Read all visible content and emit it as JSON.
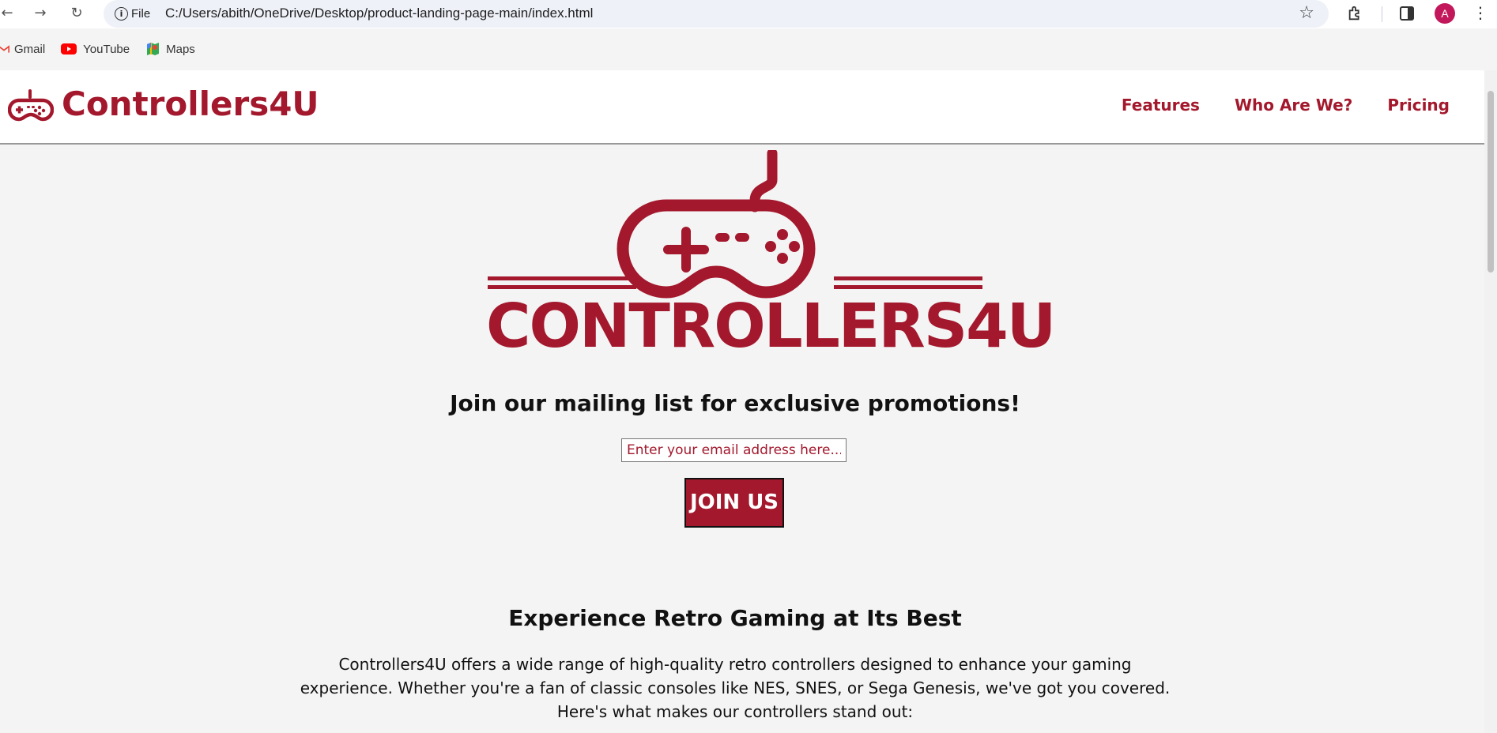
{
  "browser": {
    "file_chip_label": "File",
    "url": "C:/Users/abith/OneDrive/Desktop/product-landing-page-main/index.html",
    "avatar_letter": "A"
  },
  "bookmarks": [
    {
      "label": "Gmail",
      "icon": "gmail-icon"
    },
    {
      "label": "YouTube",
      "icon": "youtube-icon"
    },
    {
      "label": "Maps",
      "icon": "maps-icon"
    }
  ],
  "header": {
    "brand": "Controllers4U",
    "nav": [
      {
        "label": "Features"
      },
      {
        "label": "Who Are We?"
      },
      {
        "label": "Pricing"
      }
    ]
  },
  "hero": {
    "logo_text": "CONTROLLERS4U",
    "mailing_heading": "Join our mailing list for exclusive promotions!",
    "email_placeholder": "Enter your email address here...",
    "join_button": "JOIN US"
  },
  "section": {
    "heading": "Experience Retro Gaming at Its Best",
    "text": "Controllers4U offers a wide range of high-quality retro controllers designed to enhance your gaming experience. Whether you're a fan of classic consoles like NES, SNES, or Sega Genesis, we've got you covered. Here's what makes our controllers stand out:"
  },
  "colors": {
    "brand": "#a3182c",
    "page_bg": "#f4f4f4",
    "avatar": "#c2185b"
  }
}
